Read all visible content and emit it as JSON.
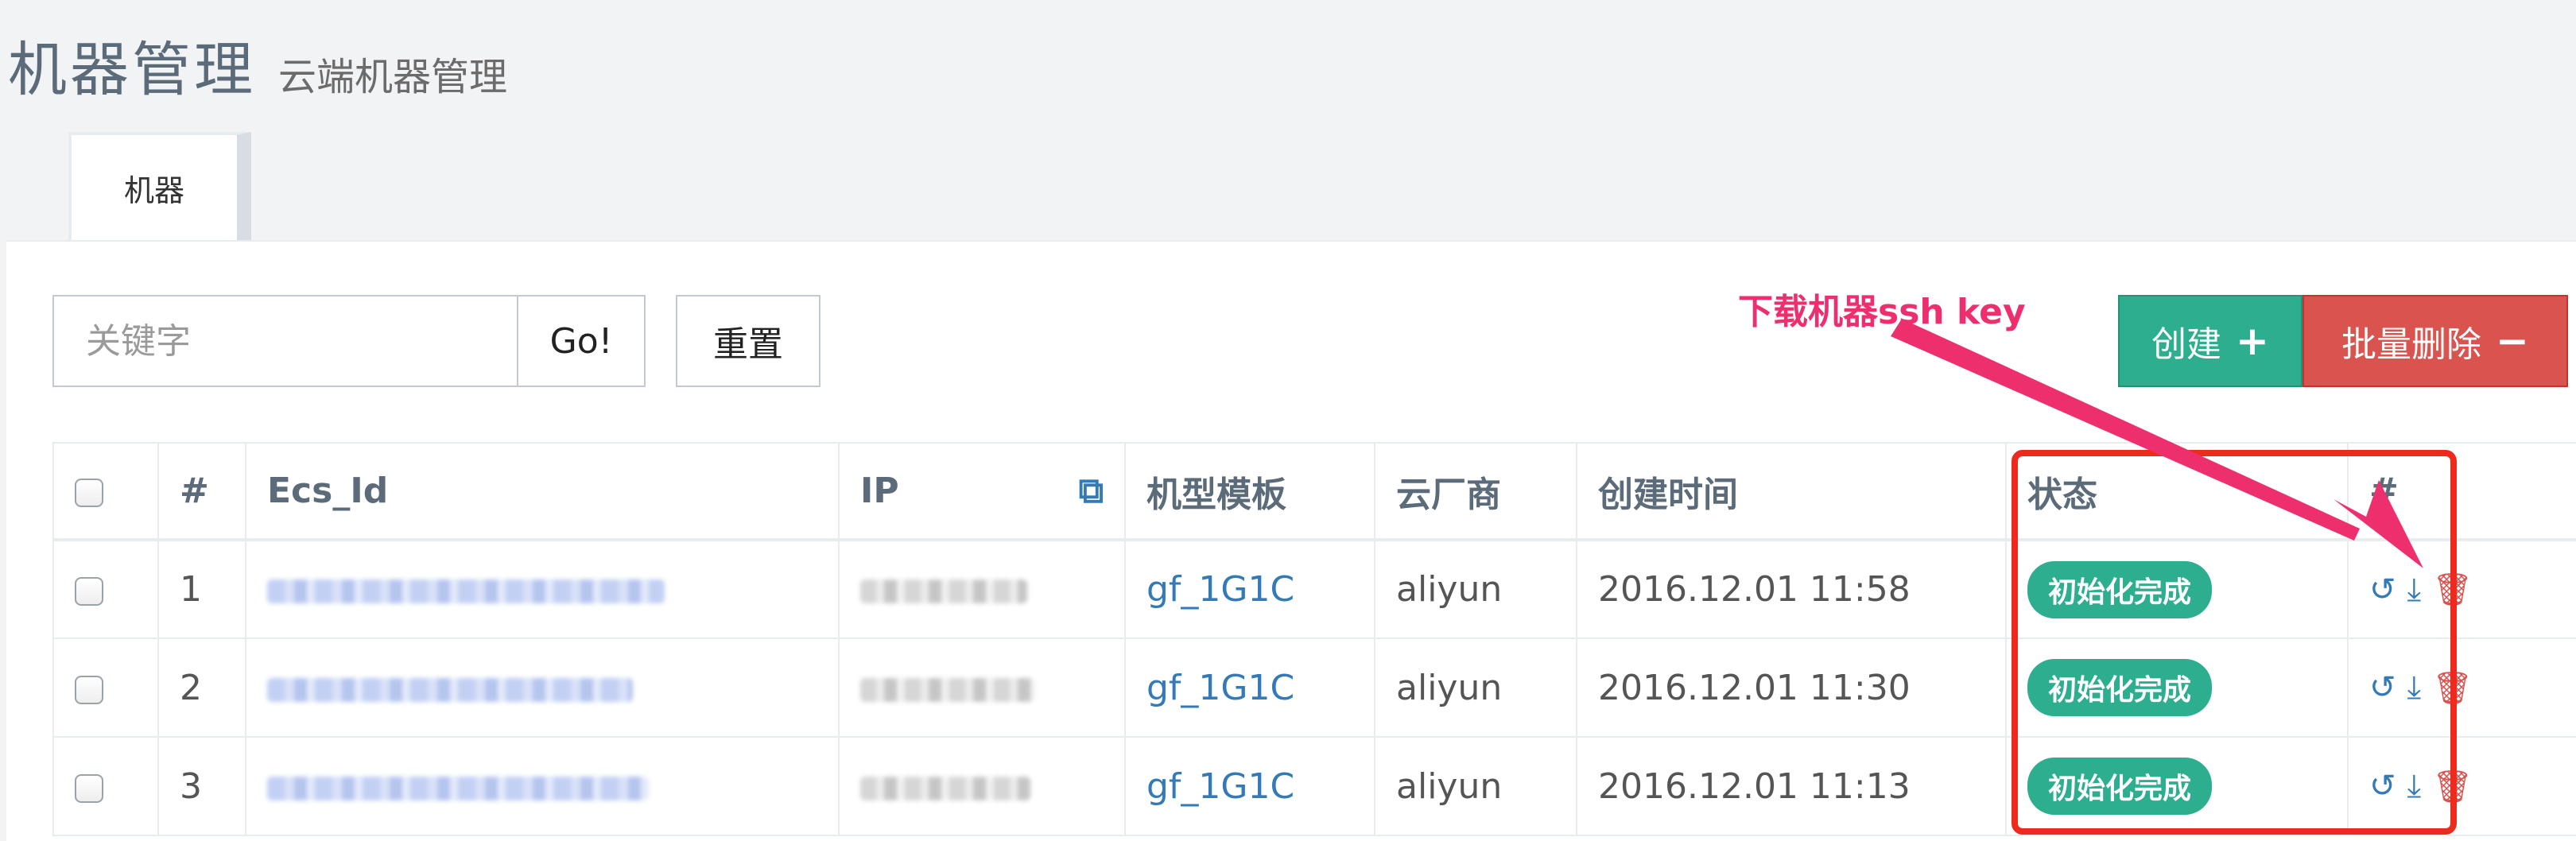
{
  "header": {
    "title": "机器管理",
    "subtitle": "云端机器管理"
  },
  "tabs": [
    {
      "label": "机器"
    }
  ],
  "toolbar": {
    "search_placeholder": "关键字",
    "go_label": "Go!",
    "reset_label": "重置",
    "create_label": "创建",
    "create_icon": "+",
    "batch_delete_label": "批量删除",
    "batch_delete_icon": "−"
  },
  "annotation": {
    "text": "下载机器ssh key"
  },
  "table": {
    "columns": [
      "#",
      "Ecs_Id",
      "IP",
      "机型模板",
      "云厂商",
      "创建时间",
      "状态",
      "#"
    ],
    "rows": [
      {
        "index": "1",
        "template": "gf_1G1C",
        "provider": "aliyun",
        "created": "2016.12.01 11:58",
        "status": "初始化完成"
      },
      {
        "index": "2",
        "template": "gf_1G1C",
        "provider": "aliyun",
        "created": "2016.12.01 11:30",
        "status": "初始化完成"
      },
      {
        "index": "3",
        "template": "gf_1G1C",
        "provider": "aliyun",
        "created": "2016.12.01 11:13",
        "status": "初始化完成"
      }
    ]
  },
  "colors": {
    "accent": "#2cae8f",
    "danger": "#d9534f",
    "link": "#337ab7",
    "annotation": "#ee2f6e"
  }
}
